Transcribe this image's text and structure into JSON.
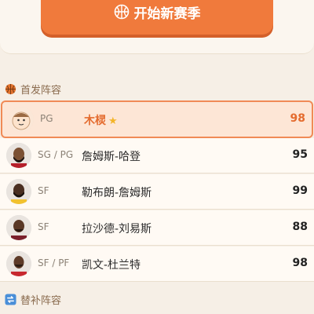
{
  "header": {
    "new_season_label": "开始新赛季"
  },
  "starters": {
    "title": "首发阵容",
    "players": [
      {
        "position": "PG",
        "name": "木棂",
        "rating": "98",
        "is_user": true
      },
      {
        "position": "SG / PG",
        "name": "詹姆斯-哈登",
        "rating": "95",
        "is_user": false
      },
      {
        "position": "SF",
        "name": "勒布朗-詹姆斯",
        "rating": "99",
        "is_user": false
      },
      {
        "position": "SF",
        "name": "拉沙德-刘易斯",
        "rating": "88",
        "is_user": false
      },
      {
        "position": "SF / PF",
        "name": "凯文-杜兰特",
        "rating": "98",
        "is_user": false
      }
    ]
  },
  "bench": {
    "title": "替补阵容"
  },
  "colors": {
    "accent": "#f07a3c",
    "highlight_bg": "#fde6d6"
  }
}
